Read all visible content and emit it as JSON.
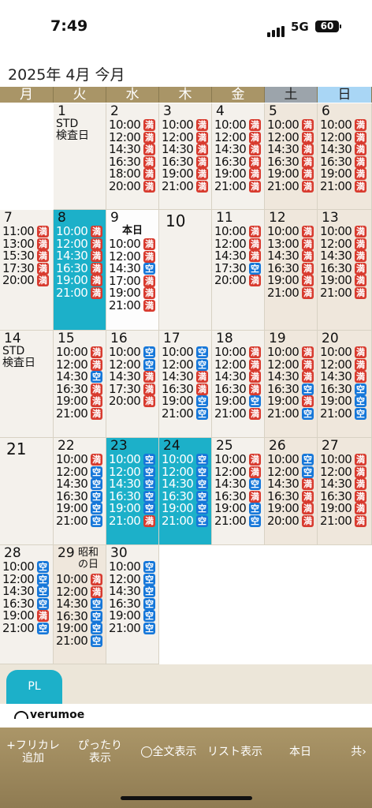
{
  "status": {
    "time": "7:49",
    "network": "5G",
    "battery": "60"
  },
  "header": {
    "title": "2025年 4月 今月"
  },
  "weekdays": [
    "月",
    "火",
    "水",
    "木",
    "金",
    "土",
    "日"
  ],
  "colors": {
    "full": "#d83b2f",
    "open": "#1677d9",
    "highlight": "#1cb0c9",
    "gold": "#a99567"
  },
  "labels": {
    "full": "満",
    "open": "空"
  },
  "weeks": [
    [
      null,
      {
        "d": "1",
        "note": "STD\n検査日",
        "slots": []
      },
      {
        "d": "2",
        "slots": [
          [
            "10:00",
            "満"
          ],
          [
            "12:00",
            "満"
          ],
          [
            "14:30",
            "満"
          ],
          [
            "16:30",
            "満"
          ],
          [
            "18:00",
            "満"
          ],
          [
            "20:00",
            "満"
          ]
        ]
      },
      {
        "d": "3",
        "slots": [
          [
            "10:00",
            "満"
          ],
          [
            "12:00",
            "満"
          ],
          [
            "14:30",
            "満"
          ],
          [
            "16:30",
            "満"
          ],
          [
            "19:00",
            "満"
          ],
          [
            "21:00",
            "満"
          ]
        ]
      },
      {
        "d": "4",
        "slots": [
          [
            "10:00",
            "満"
          ],
          [
            "12:00",
            "満"
          ],
          [
            "14:30",
            "満"
          ],
          [
            "16:30",
            "満"
          ],
          [
            "19:00",
            "満"
          ],
          [
            "21:00",
            "満"
          ]
        ]
      },
      {
        "d": "5",
        "slots": [
          [
            "10:00",
            "満"
          ],
          [
            "12:00",
            "満"
          ],
          [
            "14:30",
            "満"
          ],
          [
            "16:30",
            "満"
          ],
          [
            "19:00",
            "満"
          ],
          [
            "21:00",
            "満"
          ]
        ]
      },
      {
        "d": "6",
        "slots": [
          [
            "10:00",
            "満"
          ],
          [
            "12:00",
            "満"
          ],
          [
            "14:30",
            "満"
          ],
          [
            "16:30",
            "満"
          ],
          [
            "19:00",
            "満"
          ],
          [
            "21:00",
            "満"
          ]
        ]
      }
    ],
    [
      {
        "d": "7",
        "slots": [
          [
            "11:00",
            "満"
          ],
          [
            "13:00",
            "満"
          ],
          [
            "15:30",
            "満"
          ],
          [
            "17:30",
            "満"
          ],
          [
            "20:00",
            "満"
          ]
        ]
      },
      {
        "d": "8",
        "highlight": true,
        "slots": [
          [
            "10:00",
            "満"
          ],
          [
            "12:00",
            "満"
          ],
          [
            "14:30",
            "満"
          ],
          [
            "16:30",
            "満"
          ],
          [
            "19:00",
            "満"
          ],
          [
            "21:00",
            "満"
          ]
        ]
      },
      {
        "d": "9",
        "today": true,
        "note": "本日",
        "slots": [
          [
            "10:00",
            "満"
          ],
          [
            "12:00",
            "満"
          ],
          [
            "14:30",
            "空"
          ],
          [
            "17:00",
            "満"
          ],
          [
            "19:00",
            "満"
          ],
          [
            "21:00",
            "満"
          ]
        ]
      },
      {
        "d": "10",
        "big": true,
        "slots": []
      },
      {
        "d": "11",
        "slots": [
          [
            "10:00",
            "満"
          ],
          [
            "12:00",
            "満"
          ],
          [
            "14:30",
            "満"
          ],
          [
            "17:30",
            "空"
          ],
          [
            "20:00",
            "満"
          ]
        ]
      },
      {
        "d": "12",
        "slots": [
          [
            "10:00",
            "満"
          ],
          [
            "13:00",
            "満"
          ],
          [
            "14:30",
            "満"
          ],
          [
            "16:30",
            "満"
          ],
          [
            "19:00",
            "満"
          ],
          [
            "21:00",
            "満"
          ]
        ]
      },
      {
        "d": "13",
        "slots": [
          [
            "10:00",
            "満"
          ],
          [
            "12:00",
            "満"
          ],
          [
            "14:30",
            "満"
          ],
          [
            "16:30",
            "満"
          ],
          [
            "19:00",
            "満"
          ],
          [
            "21:00",
            "満"
          ]
        ]
      }
    ],
    [
      {
        "d": "14",
        "note": "STD\n検査日",
        "slots": []
      },
      {
        "d": "15",
        "slots": [
          [
            "10:00",
            "満"
          ],
          [
            "12:00",
            "満"
          ],
          [
            "14:30",
            "空"
          ],
          [
            "16:30",
            "満"
          ],
          [
            "19:00",
            "満"
          ],
          [
            "21:00",
            "満"
          ]
        ]
      },
      {
        "d": "16",
        "slots": [
          [
            "10:00",
            "空"
          ],
          [
            "12:00",
            "空"
          ],
          [
            "14:30",
            "満"
          ],
          [
            "17:30",
            "満"
          ],
          [
            "20:00",
            "満"
          ]
        ]
      },
      {
        "d": "17",
        "slots": [
          [
            "10:00",
            "空"
          ],
          [
            "12:00",
            "空"
          ],
          [
            "14:30",
            "満"
          ],
          [
            "16:30",
            "満"
          ],
          [
            "19:00",
            "空"
          ],
          [
            "21:00",
            "空"
          ]
        ]
      },
      {
        "d": "18",
        "slots": [
          [
            "10:00",
            "満"
          ],
          [
            "12:00",
            "満"
          ],
          [
            "14:30",
            "満"
          ],
          [
            "16:30",
            "満"
          ],
          [
            "19:00",
            "空"
          ],
          [
            "21:00",
            "満"
          ]
        ]
      },
      {
        "d": "19",
        "slots": [
          [
            "10:00",
            "満"
          ],
          [
            "12:00",
            "満"
          ],
          [
            "14:30",
            "満"
          ],
          [
            "16:30",
            "空"
          ],
          [
            "19:00",
            "満"
          ],
          [
            "21:00",
            "空"
          ]
        ]
      },
      {
        "d": "20",
        "slots": [
          [
            "10:00",
            "満"
          ],
          [
            "12:00",
            "満"
          ],
          [
            "14:30",
            "満"
          ],
          [
            "16:30",
            "空"
          ],
          [
            "19:00",
            "空"
          ],
          [
            "21:00",
            "空"
          ]
        ]
      }
    ],
    [
      {
        "d": "21",
        "big": true,
        "slots": []
      },
      {
        "d": "22",
        "slots": [
          [
            "10:00",
            "満"
          ],
          [
            "12:00",
            "空"
          ],
          [
            "14:30",
            "空"
          ],
          [
            "16:30",
            "空"
          ],
          [
            "19:00",
            "空"
          ],
          [
            "21:00",
            "空"
          ]
        ]
      },
      {
        "d": "23",
        "highlight": true,
        "slots": [
          [
            "10:00",
            "空"
          ],
          [
            "12:00",
            "空"
          ],
          [
            "14:30",
            "空"
          ],
          [
            "16:30",
            "空"
          ],
          [
            "19:00",
            "空"
          ],
          [
            "21:00",
            "満"
          ]
        ]
      },
      {
        "d": "24",
        "highlight": true,
        "slots": [
          [
            "10:00",
            "空"
          ],
          [
            "12:00",
            "空"
          ],
          [
            "14:30",
            "空"
          ],
          [
            "16:30",
            "空"
          ],
          [
            "19:00",
            "空"
          ],
          [
            "21:00",
            "空"
          ]
        ]
      },
      {
        "d": "25",
        "slots": [
          [
            "10:00",
            "満"
          ],
          [
            "12:00",
            "満"
          ],
          [
            "14:30",
            "空"
          ],
          [
            "16:30",
            "満"
          ],
          [
            "19:00",
            "空"
          ],
          [
            "21:00",
            "空"
          ]
        ]
      },
      {
        "d": "26",
        "slots": [
          [
            "10:00",
            "空"
          ],
          [
            "12:00",
            "空"
          ],
          [
            "14:30",
            "満"
          ],
          [
            "16:30",
            "満"
          ],
          [
            "19:00",
            "満"
          ],
          [
            "20:00",
            "満"
          ]
        ]
      },
      {
        "d": "27",
        "slots": [
          [
            "10:00",
            "満"
          ],
          [
            "12:00",
            "満"
          ],
          [
            "14:30",
            "満"
          ],
          [
            "16:30",
            "満"
          ],
          [
            "19:00",
            "満"
          ],
          [
            "21:00",
            "満"
          ]
        ]
      }
    ],
    [
      {
        "d": "28",
        "slots": [
          [
            "10:00",
            "空"
          ],
          [
            "12:00",
            "空"
          ],
          [
            "14:30",
            "空"
          ],
          [
            "16:30",
            "空"
          ],
          [
            "19:00",
            "満"
          ],
          [
            "21:00",
            "空"
          ]
        ]
      },
      {
        "d": "29",
        "holiday": "昭和の日",
        "slots": [
          [
            "10:00",
            "満"
          ],
          [
            "12:00",
            "満"
          ],
          [
            "14:30",
            "空"
          ],
          [
            "16:30",
            "空"
          ],
          [
            "19:00",
            "空"
          ],
          [
            "21:00",
            "空"
          ]
        ]
      },
      {
        "d": "30",
        "slots": [
          [
            "10:00",
            "空"
          ],
          [
            "12:00",
            "空"
          ],
          [
            "14:30",
            "空"
          ],
          [
            "16:30",
            "空"
          ],
          [
            "19:00",
            "空"
          ],
          [
            "21:00",
            "空"
          ]
        ]
      },
      null,
      null,
      null,
      null
    ]
  ],
  "pl": {
    "label": "PL"
  },
  "brand": {
    "name": "verumoe"
  },
  "toolbar": {
    "add": "+フリカレ\n追加",
    "fit": "ぴったり\n表示",
    "fulltext": "全文表示",
    "list": "リスト表示",
    "today": "本日",
    "share": "共"
  }
}
